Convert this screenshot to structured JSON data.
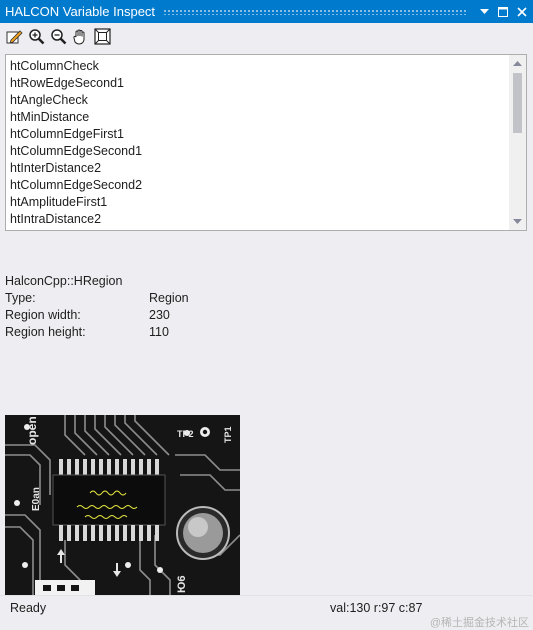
{
  "window": {
    "title": "HALCON Variable Inspect"
  },
  "toolbar": {
    "buttons": [
      {
        "icon": "edit-icon"
      },
      {
        "icon": "zoom-in-icon"
      },
      {
        "icon": "zoom-out-icon"
      },
      {
        "icon": "pan-hand-icon"
      },
      {
        "icon": "fit-window-icon"
      }
    ]
  },
  "variables": {
    "items": [
      "htColumnCheck",
      "htRowEdgeSecond1",
      "htAngleCheck",
      "htMinDistance",
      "htColumnEdgeFirst1",
      "htColumnEdgeSecond1",
      "htInterDistance2",
      "htColumnEdgeSecond2",
      "htAmplitudeFirst1",
      "htIntraDistance2"
    ]
  },
  "details": {
    "class_name": "HalconCpp::HRegion",
    "rows": [
      {
        "key": "Type:",
        "value": "Region"
      },
      {
        "key": "Region width:",
        "value": "230"
      },
      {
        "key": "Region height:",
        "value": "110"
      }
    ]
  },
  "preview": {
    "labels": [
      "open",
      "TP2",
      "E0an",
      "TP1",
      "Ю6"
    ],
    "overlay_color": "#e8e840"
  },
  "status": {
    "ready": "Ready",
    "pixel": "val:130 r:97 c:87"
  },
  "watermark": "@稀土掘金技术社区",
  "colors": {
    "accent": "#007acc",
    "panel": "#eeeef2"
  }
}
